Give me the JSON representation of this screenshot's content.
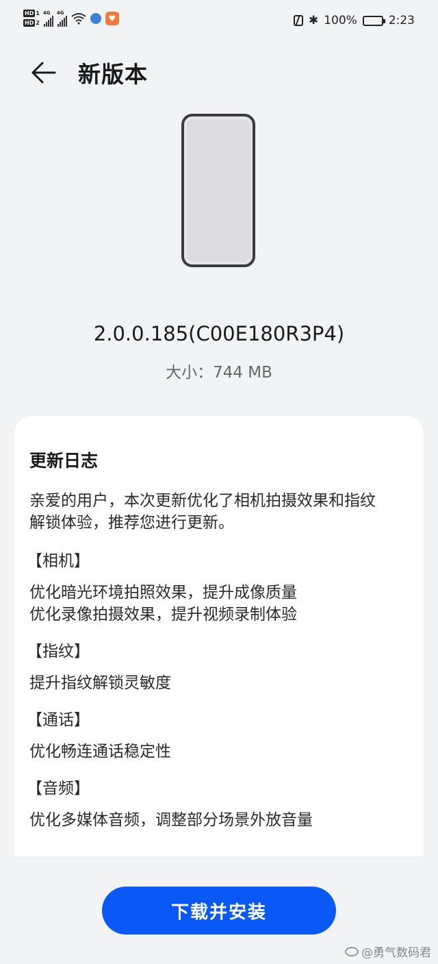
{
  "status_bar": {
    "hd1": "HD",
    "hd1_num": "1",
    "hd2": "HD",
    "hd2_num": "2",
    "net1": "4G",
    "net2": "4G",
    "battery_text": "100%",
    "time": "2:23"
  },
  "header": {
    "title": "新版本"
  },
  "update": {
    "version": "2.0.0.185(C00E180R3P4)",
    "size_label": "大小：744 MB"
  },
  "changelog": {
    "title": "更新日志",
    "intro_line1": "亲爱的用户，本次更新优化了相机拍摄效果和指纹",
    "intro_line2": "解锁体验，推荐您进行更新。",
    "sections": [
      {
        "heading": "【相机】",
        "lines": [
          "优化暗光环境拍照效果，提升成像质量",
          "优化录像拍摄效果，提升视频录制体验"
        ]
      },
      {
        "heading": "【指纹】",
        "lines": [
          "提升指纹解锁灵敏度"
        ]
      },
      {
        "heading": "【通话】",
        "lines": [
          "优化畅连通话稳定性"
        ]
      },
      {
        "heading": "【音频】",
        "lines": [
          "优化多媒体音频，调整部分场景外放音量"
        ]
      }
    ]
  },
  "actions": {
    "install_label": "下载并安装"
  },
  "watermark": "@勇气数码君",
  "colors": {
    "accent": "#0a59f7",
    "background": "#f1f3f5"
  }
}
